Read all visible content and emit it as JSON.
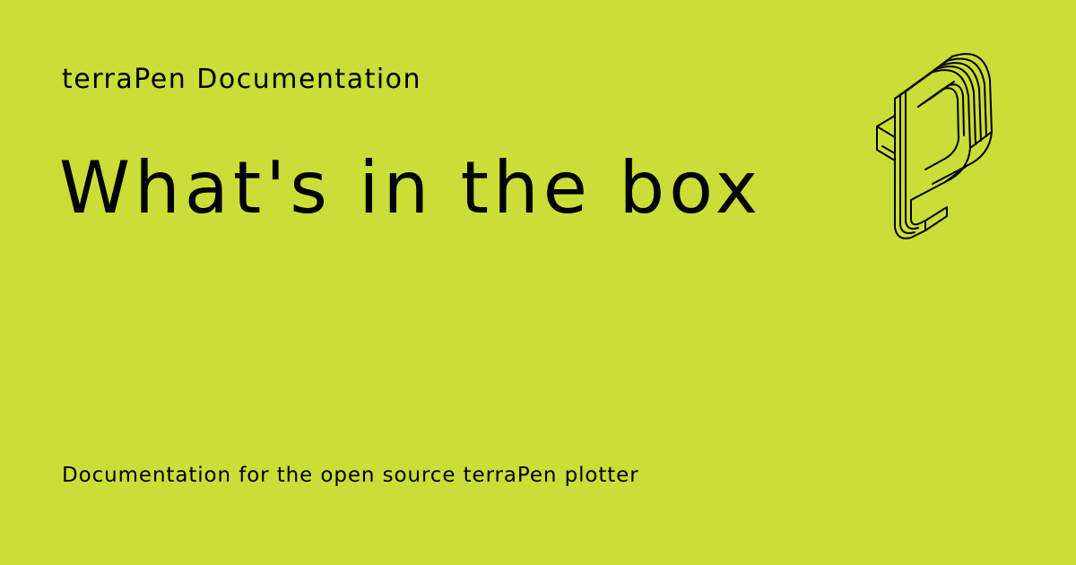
{
  "theme": {
    "background": "#cbdd37",
    "foreground": "#000000"
  },
  "site_name": "terraPen Documentation",
  "page_title": "What's in the box",
  "page_description": "Documentation for the open source terraPen plotter",
  "logo": {
    "icon": "terrapen-isometric-t-logo"
  }
}
